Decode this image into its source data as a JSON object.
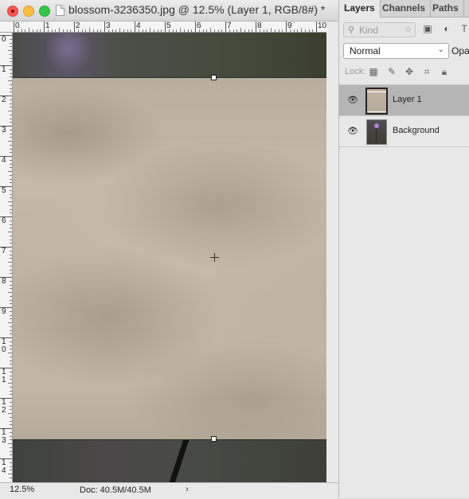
{
  "document": {
    "title": "blossom-3236350.jpg @ 12.5% (Layer 1, RGB/8#) *",
    "zoom": "12.5%",
    "doc_size": "Doc: 40.5M/40.5M",
    "status_arrow": "›"
  },
  "rulers": {
    "horizontal": [
      "0",
      "1",
      "2",
      "3",
      "4",
      "5",
      "6",
      "7",
      "8",
      "9",
      "10"
    ],
    "vertical": [
      "0",
      "1",
      "2",
      "3",
      "4",
      "5",
      "6",
      "7",
      "8",
      "9",
      "10",
      "11",
      "12",
      "13",
      "14"
    ]
  },
  "layers_panel": {
    "tabs": [
      "Layers",
      "Channels",
      "Paths"
    ],
    "kind_placeholder": "Kind",
    "blend_mode": "Normal",
    "opacity_label": "Opac",
    "lock_label": "Lock:",
    "layers": [
      {
        "name": "Layer 1",
        "visible": true,
        "selected": true
      },
      {
        "name": "Background",
        "visible": true,
        "selected": false
      }
    ]
  },
  "colors": {
    "selected_row": "#b5b5b5",
    "panel_bg": "#e8e8e8",
    "close": "#fc5753",
    "minimize": "#fdbc40",
    "maximize": "#33c748"
  },
  "icons": {
    "kind_search": "search-icon",
    "filter": [
      "image-filter-icon",
      "adjustment-filter-icon",
      "type-filter-icon"
    ],
    "locks": [
      "lock-transparent-pixels-icon",
      "lock-image-pixels-icon",
      "lock-position-icon",
      "lock-artboard-icon",
      "lock-all-icon"
    ],
    "visibility": "eye-icon"
  }
}
